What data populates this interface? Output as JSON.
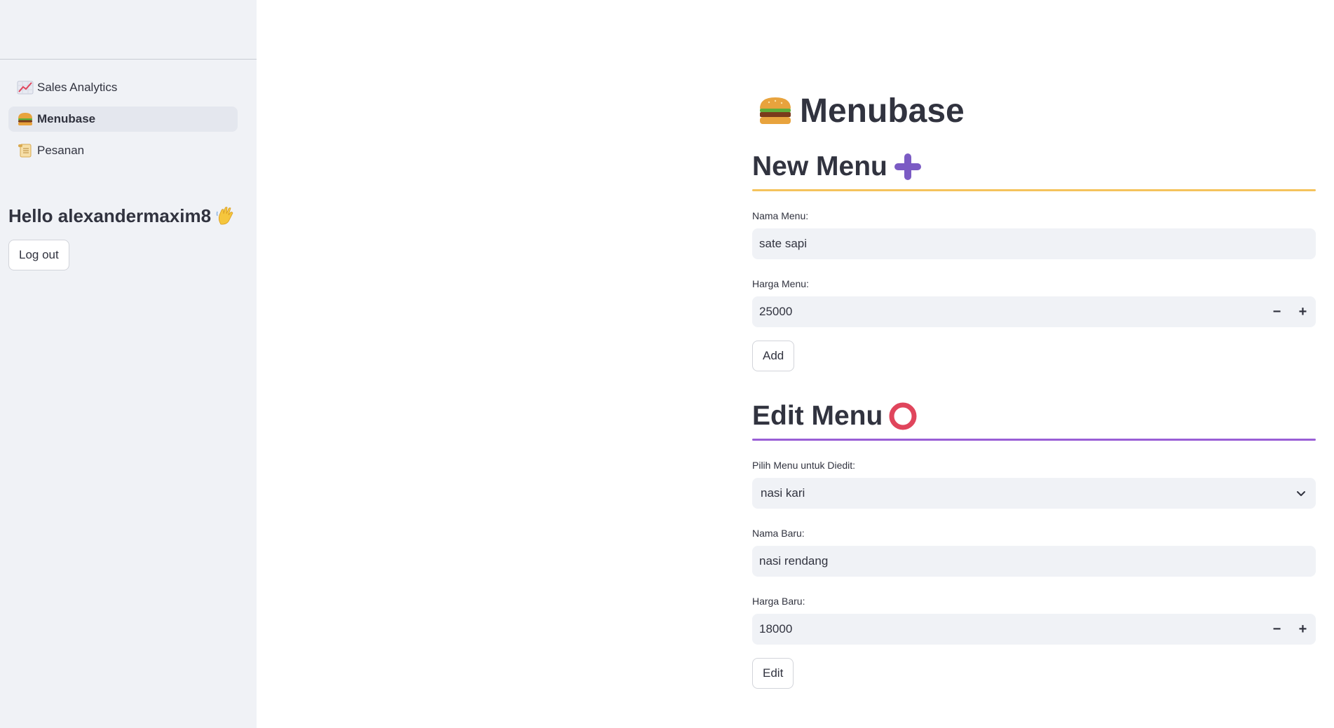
{
  "sidebar": {
    "nav": [
      {
        "icon": "chart-increasing-icon",
        "label": "Sales Analytics",
        "active": false
      },
      {
        "icon": "hamburger-icon",
        "label": "Menubase",
        "active": true
      },
      {
        "icon": "scroll-icon",
        "label": "Pesanan",
        "active": false
      }
    ],
    "greeting": "Hello alexandermaxim8",
    "greeting_icon": "waving-hand-icon",
    "logout_label": "Log out"
  },
  "main": {
    "title": "Menubase",
    "title_icon": "hamburger-icon",
    "new_menu": {
      "heading": "New Menu",
      "heading_icon": "heavy-plus-icon",
      "divider_color": "#f5c35c",
      "name_label": "Nama Menu:",
      "name_value": "sate sapi",
      "price_label": "Harga Menu:",
      "price_value": "25000",
      "minus_label": "−",
      "plus_label": "+",
      "button_label": "Add"
    },
    "edit_menu": {
      "heading": "Edit Menu",
      "heading_icon": "hollow-red-circle-icon",
      "divider_color": "#9a5fd6",
      "select_label": "Pilih Menu untuk Diedit:",
      "select_value": "nasi kari",
      "new_name_label": "Nama Baru:",
      "new_name_value": "nasi rendang",
      "new_price_label": "Harga Baru:",
      "new_price_value": "18000",
      "minus_label": "−",
      "plus_label": "+",
      "button_label": "Edit"
    }
  },
  "colors": {
    "sidebar_bg": "#f0f2f6",
    "text": "#31333f",
    "field_bg": "#f0f2f6",
    "accent_plus": "#7b5bc4",
    "accent_circle": "#e0455c"
  }
}
